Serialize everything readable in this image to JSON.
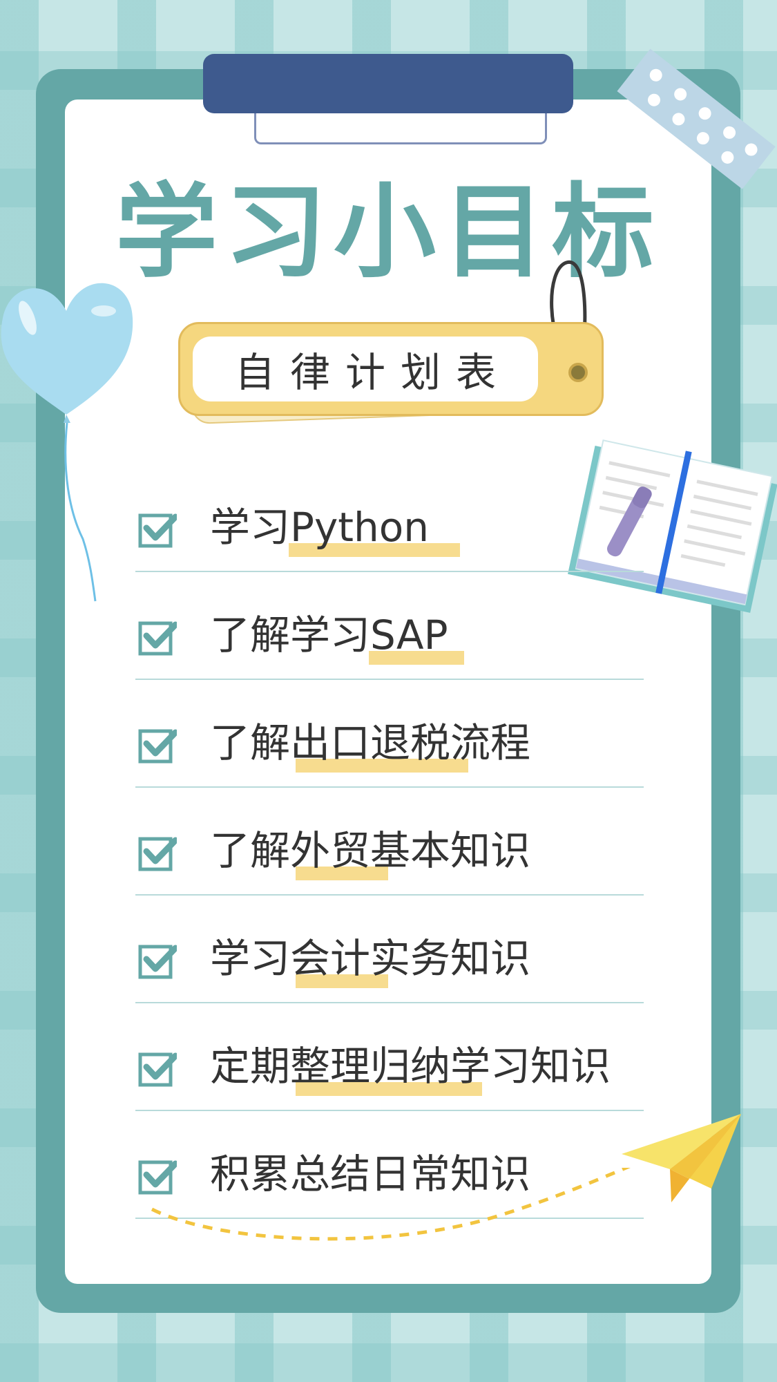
{
  "title": "学习小目标",
  "subtitle": "自律计划表",
  "goals": [
    {
      "label": "学习Python"
    },
    {
      "label": "了解学习SAP"
    },
    {
      "label": "了解出口退税流程"
    },
    {
      "label": "了解外贸基本知识"
    },
    {
      "label": "学习会计实务知识"
    },
    {
      "label": "定期整理归纳学习知识"
    },
    {
      "label": "积累总结日常知识"
    }
  ],
  "colors": {
    "primary": "#64a7a6",
    "clip": "#3e5a8e",
    "tag": "#f5d77f",
    "highlight": "#f7dc8f",
    "background": "#c6e6e6"
  },
  "icons": [
    "check-box-icon",
    "heart-balloon-icon",
    "open-book-icon",
    "pen-icon",
    "paper-plane-icon",
    "washi-tape-icon"
  ]
}
